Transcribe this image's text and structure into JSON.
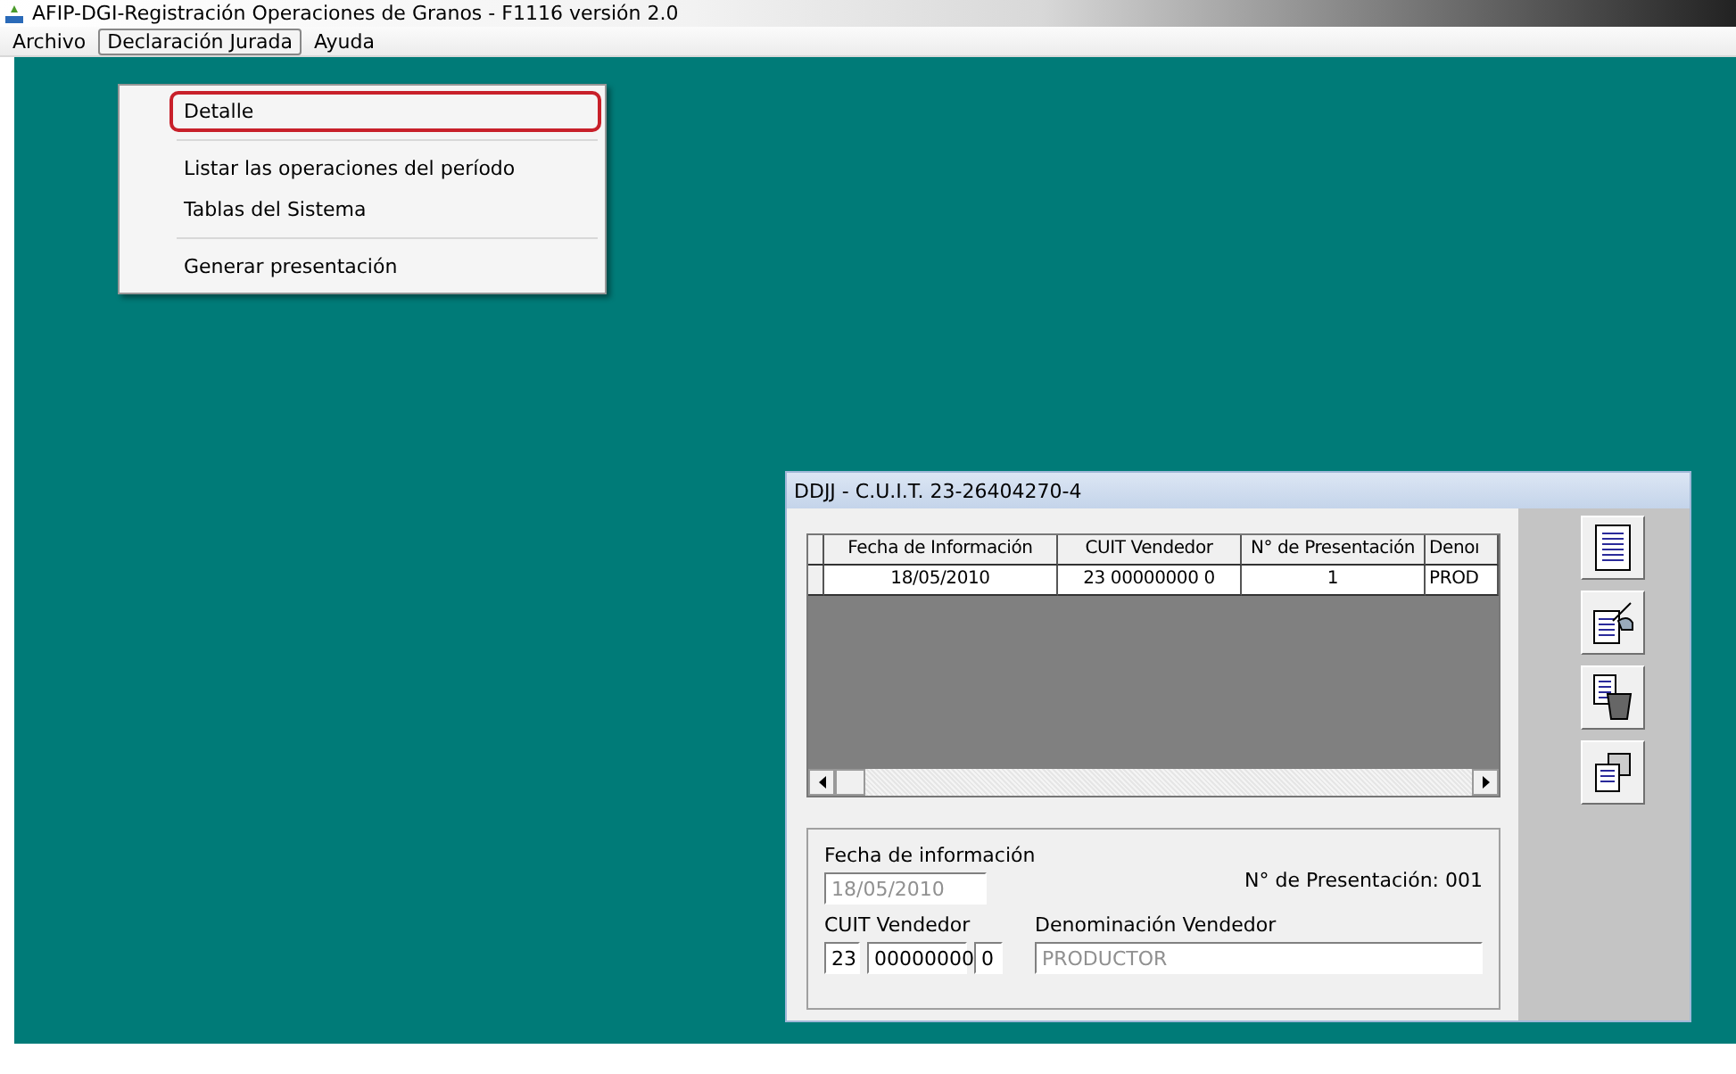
{
  "window": {
    "title": "AFIP-DGI-Registración Operaciones de Granos - F1116 versión 2.0"
  },
  "menu_bar": [
    {
      "label": "Archivo",
      "selected": false
    },
    {
      "label": "Declaración Jurada",
      "selected": true
    },
    {
      "label": "Ayuda",
      "selected": false
    }
  ],
  "dropdown": [
    {
      "label": "Detalle",
      "highlighted": true,
      "separator_before": false
    },
    {
      "label": "Listar las operaciones del período",
      "highlighted": false,
      "separator_before": true
    },
    {
      "label": "Tablas del Sistema",
      "highlighted": false,
      "separator_before": false
    },
    {
      "label": "Generar presentación",
      "highlighted": false,
      "separator_before": true
    }
  ],
  "dialog": {
    "title": "DDJJ - C.U.I.T. 23-26404270-4",
    "table": {
      "columns": [
        "Fecha de Información",
        "CUIT Vendedor",
        "N° de Presentación",
        "Denoı"
      ],
      "rows": [
        [
          "18/05/2010",
          "23 00000000 0",
          "1",
          "PROD"
        ]
      ]
    },
    "form": {
      "fecha_label": "Fecha de información",
      "fecha": {
        "value": "18/05/2010",
        "disabled": true
      },
      "presentacion": "N° de Presentación: 001",
      "cuit_label": "CUIT Vendedor",
      "cuit": [
        "23",
        "00000000",
        "0"
      ],
      "denominacion_label": "Denominación Vendedor",
      "denominacion": {
        "value": "PRODUCTOR",
        "disabled": true
      }
    }
  }
}
